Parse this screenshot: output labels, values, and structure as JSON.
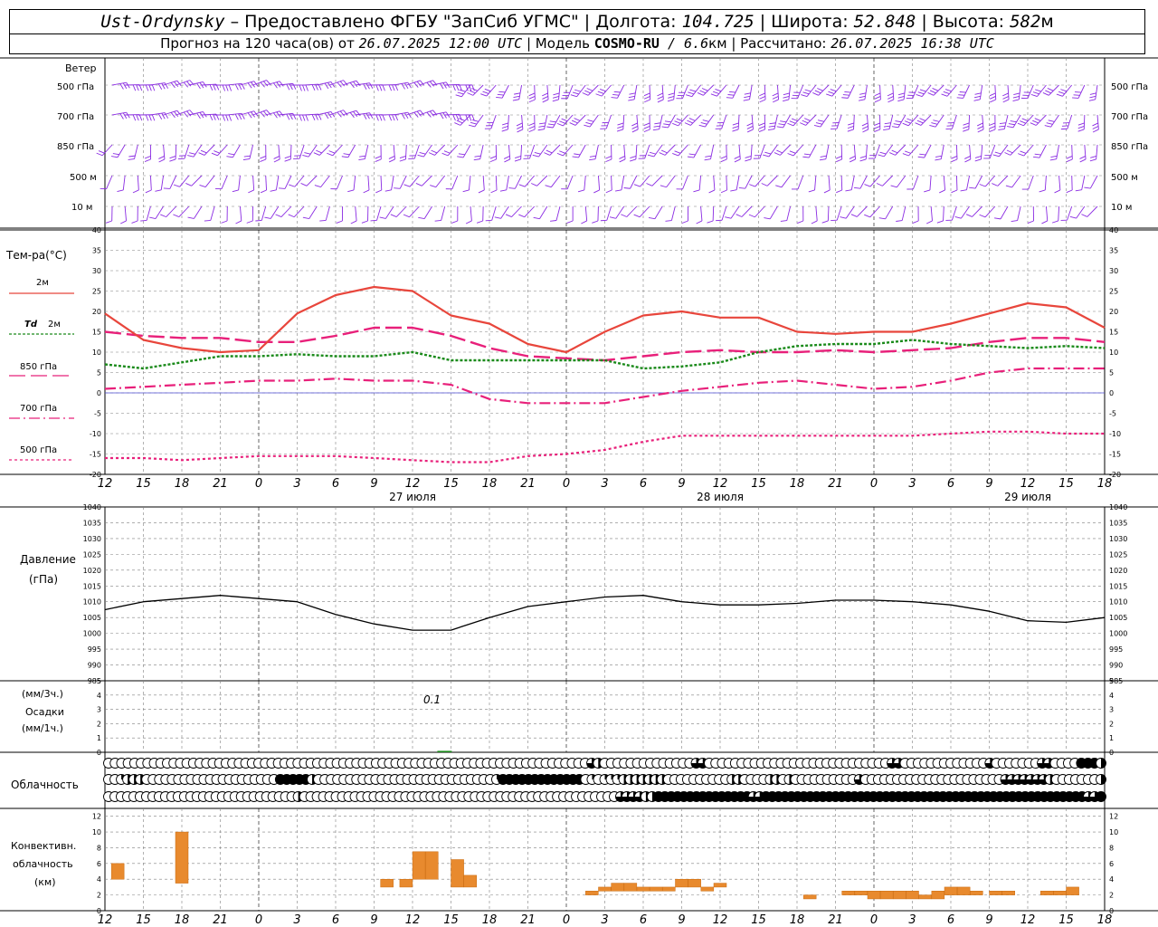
{
  "header": {
    "station": "Ust-Ordynsky",
    "dash": " – ",
    "provider_label": "Предоставлено ФГБУ \"ЗапСиб УГМС\"",
    "sep": " | ",
    "lon_label": "Долгота: ",
    "lon_value": "104.725",
    "lat_label": "Широта: ",
    "lat_value": "52.848",
    "alt_label": "Высота: ",
    "alt_value": "582",
    "alt_unit": "м",
    "forecast_label": "Прогноз на 120 часа(ов) от ",
    "forecast_time": "26.07.2025 12:00 UTC",
    "model_label": " | Модель ",
    "model_name": "COSMO-RU",
    "model_res": " / 6.6",
    "model_res_unit": "км",
    "calc_label": " | Рассчитано: ",
    "calc_time": "26.07.2025 16:38 UTC"
  },
  "wind": {
    "title": "Ветер",
    "levels": [
      "500 гПа",
      "700 гПа",
      "850 гПа",
      "500 м",
      "10 м"
    ],
    "color": "#8a2be2"
  },
  "temp_panel": {
    "title": "Тем-ра(°C)",
    "legend": [
      {
        "label": "2м",
        "label_prefix": "",
        "color": "#e8463c",
        "dash": ""
      },
      {
        "label": "2м",
        "label_prefix": "Td",
        "color": "#1a8a1a",
        "dash": "3,2"
      },
      {
        "label": "850 гПа",
        "label_prefix": "",
        "color": "#e8207a",
        "dash": "18,6"
      },
      {
        "label": "700 гПа",
        "label_prefix": "",
        "color": "#e8207a",
        "dash": "12,4,2,4"
      },
      {
        "label": "500 гПа",
        "label_prefix": "",
        "color": "#e8207a",
        "dash": "3,3"
      }
    ]
  },
  "pressure_panel": {
    "title": "Давление",
    "unit": "(гПа)"
  },
  "precip_panel": {
    "unit3": "(мм/3ч.)",
    "title": "Осадки",
    "unit1": "(мм/1ч.)",
    "annotation": "0.1"
  },
  "cloud_panel": {
    "title": "Облачность"
  },
  "conv_panel": {
    "title1": "Конвективн.",
    "title2": "облачность",
    "unit": "(км)"
  },
  "time_axis": {
    "hour_labels": [
      "12",
      "15",
      "18",
      "21",
      "0",
      "3",
      "6",
      "9",
      "12",
      "15",
      "18",
      "21",
      "0",
      "3",
      "6",
      "9",
      "12",
      "15",
      "18",
      "21",
      "0",
      "3",
      "6",
      "9",
      "12",
      "15",
      "18"
    ],
    "day_labels": [
      "27 июля",
      "28 июля",
      "29 июля"
    ],
    "start": "26.07.2025 12:00 UTC",
    "step_hours": 3
  },
  "chart_data": [
    {
      "type": "line",
      "title": "Тем-ра(°C)",
      "x_hours": [
        0,
        3,
        6,
        9,
        12,
        15,
        18,
        21,
        24,
        27,
        30,
        33,
        36,
        39,
        42,
        45,
        48,
        51,
        54,
        57,
        60,
        63,
        66,
        69,
        72,
        75,
        78
      ],
      "ylim": [
        -20,
        40
      ],
      "grid": true,
      "series": [
        {
          "name": "2м",
          "values": [
            19.5,
            13,
            11,
            10,
            10.5,
            19.5,
            24,
            26,
            25,
            19,
            17,
            12,
            10,
            15,
            19,
            20,
            18.5,
            18.5,
            15,
            14.5,
            15,
            15,
            17,
            19.5,
            22,
            21,
            16
          ]
        },
        {
          "name": "Td 2м",
          "values": [
            7,
            6,
            7.5,
            9,
            9,
            9.5,
            9,
            9,
            10,
            8,
            8,
            8,
            8,
            8,
            6,
            6.5,
            7.5,
            10,
            11.5,
            12,
            12,
            13,
            12,
            11.5,
            11,
            11.5,
            11
          ]
        },
        {
          "name": "850 гПа",
          "values": [
            15,
            14,
            13.5,
            13.5,
            12.5,
            12.5,
            14,
            16,
            16,
            14,
            11,
            9,
            8.5,
            8,
            9,
            10,
            10.5,
            10,
            10,
            10.5,
            10,
            10.5,
            11,
            12.5,
            13.5,
            13.5,
            12.5
          ]
        },
        {
          "name": "700 гПа",
          "values": [
            1,
            1.5,
            2,
            2.5,
            3,
            3,
            3.5,
            3,
            3,
            2,
            -1.5,
            -2.5,
            -2.5,
            -2.5,
            -1,
            0.5,
            1.5,
            2.5,
            3,
            2,
            1,
            1.5,
            3,
            5,
            6,
            6,
            6
          ]
        },
        {
          "name": "500 гПа",
          "values": [
            -16,
            -16,
            -16.5,
            -16,
            -15.5,
            -15.5,
            -15.5,
            -16,
            -16.5,
            -17,
            -17,
            -15.5,
            -15,
            -14,
            -12,
            -10.5,
            -10.5,
            -10.5,
            -10.5,
            -10.5,
            -10.5,
            -10.5,
            -10,
            -9.5,
            -9.5,
            -10,
            -10
          ]
        }
      ]
    },
    {
      "type": "line",
      "title": "Давление",
      "x_hours": [
        0,
        3,
        6,
        9,
        12,
        15,
        18,
        21,
        24,
        27,
        30,
        33,
        36,
        39,
        42,
        45,
        48,
        51,
        54,
        57,
        60,
        63,
        66,
        69,
        72,
        75,
        78
      ],
      "ylim": [
        985,
        1040
      ],
      "grid": true,
      "series": [
        {
          "name": "Давление",
          "values": [
            1007.5,
            1010,
            1011,
            1012,
            1011,
            1010,
            1006,
            1003,
            1001,
            1001,
            1005,
            1008.5,
            1010,
            1011.5,
            1012,
            1010,
            1009,
            1009,
            1009.5,
            1010.5,
            1010.5,
            1010,
            1009,
            1007,
            1004,
            1003.5,
            1005
          ]
        }
      ]
    },
    {
      "type": "bar",
      "title": "Осадки",
      "ylim": [
        0,
        5
      ],
      "bars": [
        {
          "x_hours": 26.5,
          "value": 0.1
        }
      ]
    },
    {
      "type": "bar",
      "title": "Конвективн. облачность",
      "ylim": [
        0,
        13
      ],
      "bars": [
        {
          "x_hours": 1,
          "low": 4,
          "high": 6
        },
        {
          "x_hours": 6,
          "low": 3.5,
          "high": 10
        },
        {
          "x_hours": 22,
          "low": 3,
          "high": 4
        },
        {
          "x_hours": 23.5,
          "low": 3,
          "high": 4
        },
        {
          "x_hours": 24.5,
          "low": 4,
          "high": 7.5
        },
        {
          "x_hours": 25.5,
          "low": 4,
          "high": 7.5
        },
        {
          "x_hours": 27.5,
          "low": 3,
          "high": 6.5
        },
        {
          "x_hours": 28.5,
          "low": 3,
          "high": 4.5
        },
        {
          "x_hours": 38,
          "low": 2,
          "high": 2.5
        },
        {
          "x_hours": 39,
          "low": 2.5,
          "high": 3
        },
        {
          "x_hours": 40,
          "low": 2.5,
          "high": 3.5
        },
        {
          "x_hours": 41,
          "low": 2.5,
          "high": 3.5
        },
        {
          "x_hours": 42,
          "low": 2.5,
          "high": 3
        },
        {
          "x_hours": 43,
          "low": 2.5,
          "high": 3
        },
        {
          "x_hours": 44,
          "low": 2.5,
          "high": 3
        },
        {
          "x_hours": 45,
          "low": 3,
          "high": 4
        },
        {
          "x_hours": 46,
          "low": 3,
          "high": 4
        },
        {
          "x_hours": 47,
          "low": 2.5,
          "high": 3
        },
        {
          "x_hours": 48,
          "low": 3,
          "high": 3.5
        },
        {
          "x_hours": 55,
          "low": 1.5,
          "high": 2
        },
        {
          "x_hours": 58,
          "low": 2,
          "high": 2.5
        },
        {
          "x_hours": 59,
          "low": 2,
          "high": 2.5
        },
        {
          "x_hours": 60,
          "low": 1.5,
          "high": 2.5
        },
        {
          "x_hours": 61,
          "low": 1.5,
          "high": 2.5
        },
        {
          "x_hours": 62,
          "low": 1.5,
          "high": 2.5
        },
        {
          "x_hours": 63,
          "low": 1.5,
          "high": 2.5
        },
        {
          "x_hours": 64,
          "low": 1.5,
          "high": 2
        },
        {
          "x_hours": 65,
          "low": 1.5,
          "high": 2.5
        },
        {
          "x_hours": 66,
          "low": 2,
          "high": 3
        },
        {
          "x_hours": 67,
          "low": 2,
          "high": 3
        },
        {
          "x_hours": 68,
          "low": 2,
          "high": 2.5
        },
        {
          "x_hours": 69.5,
          "low": 2,
          "high": 2.5
        },
        {
          "x_hours": 70.5,
          "low": 2,
          "high": 2.5
        },
        {
          "x_hours": 73.5,
          "low": 2,
          "high": 2.5
        },
        {
          "x_hours": 74.5,
          "low": 2,
          "high": 2.5
        },
        {
          "x_hours": 75.5,
          "low": 2,
          "high": 3
        }
      ]
    }
  ],
  "cloud_cover": {
    "rows": [
      [
        0,
        0,
        0,
        0,
        0,
        0,
        0,
        0,
        0,
        0,
        0,
        0,
        0,
        0,
        0,
        0,
        0,
        0,
        0,
        0,
        0,
        0,
        0,
        0,
        0,
        0,
        0,
        0,
        0,
        0,
        0,
        0,
        0,
        0,
        0,
        0,
        0,
        0,
        0,
        0,
        0,
        0,
        0,
        0,
        0,
        0,
        0,
        0,
        0,
        0,
        0,
        0,
        0,
        0,
        0,
        0,
        0,
        0,
        0,
        0,
        0,
        0,
        0,
        0,
        0,
        0,
        0,
        0,
        0,
        0,
        0,
        0,
        0,
        0,
        3,
        2,
        0,
        0,
        0,
        0,
        0,
        0,
        0,
        0,
        0,
        0,
        0,
        0,
        0,
        0,
        3,
        3,
        0,
        0,
        0,
        0,
        0,
        0,
        0,
        0,
        0,
        0,
        0,
        0,
        0,
        0,
        0,
        0,
        0,
        0,
        0,
        0,
        0,
        0,
        0,
        0,
        0,
        0,
        0,
        0,
        3,
        3,
        0,
        0,
        0,
        0,
        0,
        0,
        0,
        0,
        0,
        0,
        0,
        0,
        0,
        3,
        0,
        0,
        0,
        0,
        0,
        0,
        0,
        3,
        3,
        0,
        0,
        0,
        0,
        4,
        4,
        4,
        2
      ],
      [
        0,
        0,
        1,
        2,
        2,
        2,
        0,
        0,
        0,
        0,
        0,
        0,
        0,
        0,
        0,
        0,
        0,
        0,
        0,
        0,
        0,
        0,
        0,
        0,
        0,
        0,
        0,
        4,
        4,
        4,
        4,
        4,
        2,
        0,
        0,
        0,
        0,
        0,
        0,
        0,
        0,
        0,
        0,
        0,
        0,
        0,
        0,
        0,
        0,
        0,
        0,
        0,
        0,
        0,
        0,
        0,
        0,
        0,
        0,
        0,
        0,
        1,
        4,
        4,
        4,
        4,
        4,
        4,
        4,
        4,
        4,
        4,
        4,
        4,
        4,
        0,
        1,
        0,
        1,
        1,
        1,
        2,
        2,
        2,
        2,
        2,
        2,
        2,
        0,
        0,
        0,
        0,
        0,
        0,
        0,
        0,
        0,
        0,
        2,
        2,
        0,
        0,
        0,
        0,
        2,
        2,
        0,
        2,
        0,
        0,
        0,
        0,
        0,
        0,
        0,
        0,
        0,
        0,
        3,
        0,
        0,
        0,
        0,
        0,
        0,
        0,
        0,
        0,
        0,
        0,
        0,
        0,
        0,
        0,
        0,
        0,
        0,
        0,
        0,
        0,
        0,
        3,
        3,
        3,
        3,
        3,
        3,
        3,
        2,
        0,
        0,
        0,
        0,
        0,
        0,
        0,
        2
      ],
      [
        0,
        0,
        0,
        0,
        0,
        0,
        0,
        0,
        0,
        0,
        0,
        0,
        0,
        0,
        0,
        0,
        0,
        0,
        0,
        0,
        0,
        0,
        0,
        0,
        0,
        0,
        0,
        0,
        0,
        0,
        2,
        0,
        0,
        0,
        0,
        0,
        0,
        0,
        0,
        0,
        0,
        0,
        0,
        0,
        0,
        0,
        0,
        0,
        0,
        0,
        0,
        0,
        0,
        0,
        0,
        0,
        0,
        0,
        0,
        0,
        0,
        0,
        0,
        0,
        0,
        0,
        0,
        0,
        0,
        0,
        0,
        0,
        0,
        0,
        0,
        0,
        0,
        0,
        0,
        0,
        0,
        3,
        3,
        3,
        3,
        2,
        2,
        4,
        4,
        4,
        4,
        4,
        4,
        4,
        4,
        4,
        4,
        4,
        4,
        4,
        4,
        4,
        3,
        3,
        4,
        4,
        4,
        4,
        4,
        4,
        4,
        4,
        4,
        4,
        4,
        4,
        4,
        4,
        4,
        4,
        4,
        4,
        4,
        4,
        4,
        4,
        4,
        4,
        4,
        4,
        4,
        4,
        4,
        4,
        4,
        4,
        4,
        4,
        4,
        4,
        4,
        4,
        4,
        4,
        4,
        4,
        4,
        4,
        4,
        4,
        4,
        4,
        4,
        4,
        4,
        3,
        3,
        4
      ]
    ]
  },
  "wind_barbs": {
    "pattern": [
      "lll",
      "lm",
      "mm",
      "mms",
      "sms"
    ]
  },
  "colors": {
    "grid": "#808080",
    "wind": "#8a2be2",
    "temp2m": "#e8463c",
    "td": "#1a8a1a",
    "isobar": "#e8207a",
    "pressure": "#000000",
    "precip": "#1a8a1a",
    "conv": "#e88a2e",
    "zero_line": "#4a4ad0"
  }
}
